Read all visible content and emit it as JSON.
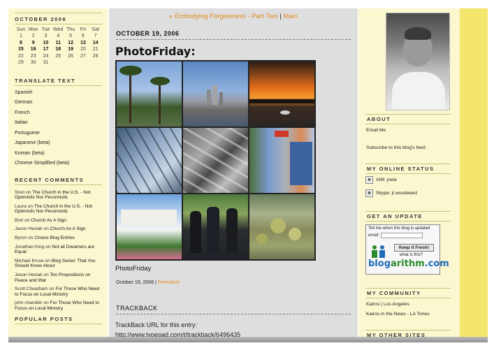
{
  "calendar": {
    "title": "OCTOBER 2006",
    "days": [
      "Sun",
      "Mon",
      "Tue",
      "Wed",
      "Thu",
      "Fri",
      "Sat"
    ],
    "weeks": [
      [
        "",
        "1",
        "2",
        "3",
        "4",
        "5",
        "6",
        "7"
      ],
      [
        "8",
        "9",
        "10",
        "11",
        "12",
        "13",
        "14"
      ],
      [
        "15",
        "16",
        "17",
        "18",
        "19",
        "20",
        "21"
      ],
      [
        "22",
        "23",
        "24",
        "25",
        "26",
        "27",
        "28"
      ],
      [
        "29",
        "30",
        "31",
        "",
        "",
        "",
        ""
      ]
    ]
  },
  "translate": {
    "title": "TRANSLATE TEXT",
    "items": [
      "Spanish",
      "German",
      "French",
      "Italian",
      "Portuguese",
      "Japanese (beta)",
      "Korean (beta)",
      "Chinese Simplified (beta)"
    ]
  },
  "recent_comments": {
    "title": "RECENT COMMENTS",
    "items": [
      {
        "author": "Sivin",
        "on": "on",
        "post": "The Church in the U.S. - Not Optimistic Nor Pessimistic"
      },
      {
        "author": "Laura",
        "on": "on",
        "post": "The Church in the U.S. - Not Optimistic Nor Pessimistic"
      },
      {
        "author": "Bret",
        "on": "on",
        "post": "Church As A Sign"
      },
      {
        "author": "Jaosn Hesiak",
        "on": "on",
        "post": "Church As A Sign"
      },
      {
        "author": "Byron",
        "on": "on",
        "post": "Choice Blog Entries"
      },
      {
        "author": "Jonathan King",
        "on": "on",
        "post": "Not all Dreamers are Equal"
      },
      {
        "author": "Michael Kruse",
        "on": "on",
        "post": "Blog Series' That You Should Know About"
      },
      {
        "author": "Jason Hesiak",
        "on": "on",
        "post": "Ten Propositions on Peace and War"
      },
      {
        "author": "Scott Cheatham",
        "on": "on",
        "post": "For Those Who Need to Focus on Local Ministry"
      },
      {
        "author": "john chandler",
        "on": "on",
        "post": "For Those Who Need to Focus on Local Ministry"
      }
    ]
  },
  "popular_posts": {
    "title": "POPULAR POSTS"
  },
  "nav": {
    "prev": "« Embodying Forgiveness - Part Two",
    "sep": "|",
    "main": "Main"
  },
  "post": {
    "date": "OCTOBER 19, 2006",
    "title": "PhotoFriday:",
    "caption": "PhotoFriday",
    "meta_date": "October 19, 2006",
    "meta_sep": "|",
    "permalink": "Permalink"
  },
  "trackback": {
    "title": "TRACKBACK",
    "label": "TrackBack URL for this entry:",
    "url": "http://www.typepad.com/t/trackback/6496435"
  },
  "about": {
    "title": "ABOUT",
    "email": "Email Me",
    "subscribe": "Subscribe to this blog's feed"
  },
  "online_status": {
    "title": "MY ONLINE STATUS",
    "aim": "AIM: jrwla",
    "skype": "Skype: jr.woodward"
  },
  "update": {
    "title": "GET AN UPDATE",
    "tell_me": "Tell me when this blog is updated",
    "email_label": "email:",
    "button": "Keep it Fresh!",
    "what": "what is this?",
    "logo_blog": "blog",
    "logo_arithm": "arithm",
    "logo_com": ".com"
  },
  "community": {
    "title": "MY COMMUNITY",
    "item1_a": "Kairos",
    "item1_sep": "|",
    "item1_b": "Los Angeles",
    "item2": "Kairos in the News - LA Times"
  },
  "other_sites": {
    "title": "MY OTHER SITES"
  },
  "colors": {
    "accent": "#e28a1e",
    "sidebar": "#fbf7cf",
    "content": "#dedede",
    "stripe": "#f4e56d"
  }
}
